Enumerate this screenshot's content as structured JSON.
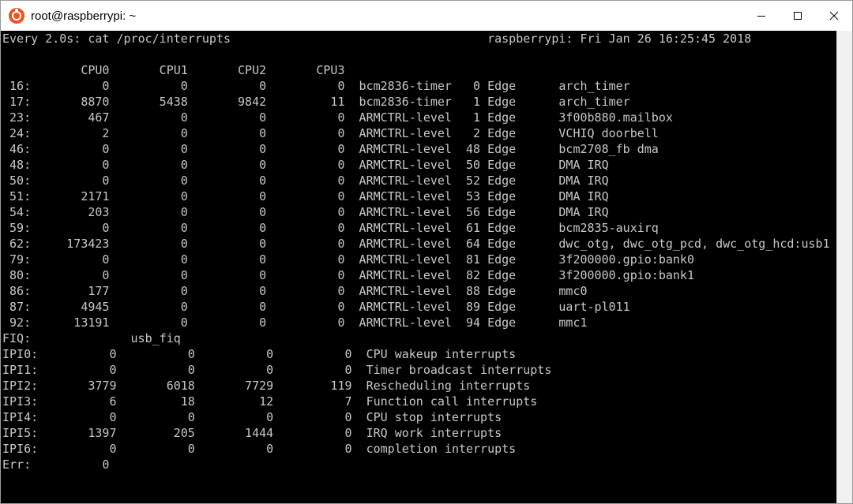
{
  "window": {
    "title": "root@raspberrypi: ~",
    "icon": "ubuntu-icon",
    "controls": [
      "minimize-icon",
      "maximize-icon",
      "close-icon"
    ]
  },
  "terminal": {
    "lines": [
      "Every 2.0s: cat /proc/interrupts                                    raspberrypi: Fri Jan 26 16:25:45 2018",
      "",
      "           CPU0       CPU1       CPU2       CPU3",
      " 16:          0          0          0          0  bcm2836-timer   0 Edge      arch_timer",
      " 17:       8870       5438       9842         11  bcm2836-timer   1 Edge      arch_timer",
      " 23:        467          0          0          0  ARMCTRL-level   1 Edge      3f00b880.mailbox",
      " 24:          2          0          0          0  ARMCTRL-level   2 Edge      VCHIQ doorbell",
      " 46:          0          0          0          0  ARMCTRL-level  48 Edge      bcm2708_fb dma",
      " 48:          0          0          0          0  ARMCTRL-level  50 Edge      DMA IRQ",
      " 50:          0          0          0          0  ARMCTRL-level  52 Edge      DMA IRQ",
      " 51:       2171          0          0          0  ARMCTRL-level  53 Edge      DMA IRQ",
      " 54:        203          0          0          0  ARMCTRL-level  56 Edge      DMA IRQ",
      " 59:          0          0          0          0  ARMCTRL-level  61 Edge      bcm2835-auxirq",
      " 62:     173423          0          0          0  ARMCTRL-level  64 Edge      dwc_otg, dwc_otg_pcd, dwc_otg_hcd:usb1",
      " 79:          0          0          0          0  ARMCTRL-level  81 Edge      3f200000.gpio:bank0",
      " 80:          0          0          0          0  ARMCTRL-level  82 Edge      3f200000.gpio:bank1",
      " 86:        177          0          0          0  ARMCTRL-level  88 Edge      mmc0",
      " 87:       4945          0          0          0  ARMCTRL-level  89 Edge      uart-pl011",
      " 92:      13191          0          0          0  ARMCTRL-level  94 Edge      mmc1",
      "FIQ:              usb_fiq",
      "IPI0:          0          0          0          0  CPU wakeup interrupts",
      "IPI1:          0          0          0          0  Timer broadcast interrupts",
      "IPI2:       3779       6018       7729        119  Rescheduling interrupts",
      "IPI3:          6         18         12          7  Function call interrupts",
      "IPI4:          0          0          0          0  CPU stop interrupts",
      "IPI5:       1397        205       1444          0  IRQ work interrupts",
      "IPI6:          0          0          0          0  completion interrupts",
      "Err:          0"
    ]
  },
  "colors": {
    "terminal_bg": "#000000",
    "terminal_fg": "#c8c8c8",
    "titlebar_bg": "#ffffff",
    "app_icon": "#e95420"
  }
}
